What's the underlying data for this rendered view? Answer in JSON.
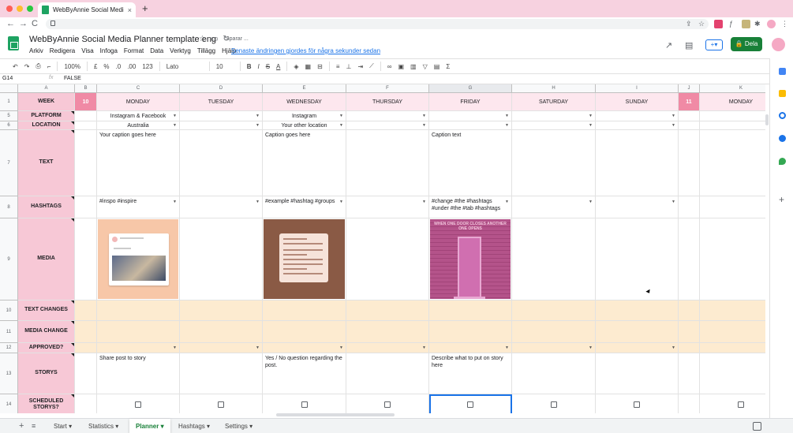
{
  "browser": {
    "tab_title": "WebByAnnie Social Media Planner template",
    "tab_close": "×",
    "new_tab": "+",
    "nav_back": "←",
    "nav_forward": "→",
    "nav_reload": "C",
    "dot_colors": [
      "#ff5f57",
      "#febc2e",
      "#28c840"
    ]
  },
  "doc": {
    "title": "WebByAnnie Social Media Planner template eng",
    "saving_status": "Sparar ...",
    "last_edit": "Senaste ändringen gjordes för några sekunder sedan",
    "share_label": "Dela",
    "menus": [
      "Arkiv",
      "Redigera",
      "Visa",
      "Infoga",
      "Format",
      "Data",
      "Verktyg",
      "Tillägg",
      "Hjälp"
    ]
  },
  "toolbar": {
    "zoom": "100%",
    "currency": "£",
    "percent": "%",
    "dec_less": ".0",
    "dec_more": ".00",
    "format_more": "123",
    "font": "Lato",
    "font_size": "10",
    "bold": "B",
    "italic": "I",
    "strike": "S",
    "text_color": "A",
    "sum": "Σ"
  },
  "formula_bar": {
    "cell_ref": "G14",
    "fx": "fx",
    "value": "FALSE"
  },
  "columns": [
    "A",
    "B",
    "C",
    "D",
    "E",
    "F",
    "G",
    "H",
    "I",
    "J",
    "K"
  ],
  "rows": {
    "numbers": [
      "1",
      "5",
      "6",
      "7",
      "8",
      "9",
      "10",
      "11",
      "12",
      "13",
      "14"
    ],
    "labels": [
      "WEEK",
      "PLATFORM",
      "LOCATION",
      "TEXT",
      "HASHTAGS",
      "MEDIA",
      "TEXT CHANGES",
      "MEDIA CHANGE",
      "APPROVED?",
      "STORYS",
      "SCHEDULED STORYS?"
    ]
  },
  "week": {
    "current": "10",
    "next": "11",
    "days": [
      "MONDAY",
      "TUESDAY",
      "WEDNESDAY",
      "THURSDAY",
      "FRIDAY",
      "SATURDAY",
      "SUNDAY"
    ],
    "next_days": [
      "MONDAY"
    ]
  },
  "cells": {
    "platform_mon": "Instagram & Facebook",
    "platform_wed": "Instagram",
    "location_mon": "Australia",
    "location_wed": "Your other location",
    "text_mon": "Your caption goes here",
    "text_wed": "Caption goes here",
    "text_fri": "Caption text",
    "hashtags_mon": "#inspo #inspire",
    "hashtags_wed": "#example #hashtag #groups",
    "hashtags_fri": "#change #the #hashtags #under #the #tab #hashtags",
    "story_mon": "Share post to story",
    "story_wed": "Yes / No question regarding the post.",
    "story_fri": "Describe what to put on story here"
  },
  "media": {
    "friday_headline": "WHEN ONE DOOR CLOSES ANOTHER ONE OPENS"
  },
  "sheet_tabs": [
    "Start",
    "Statistics",
    "Planner",
    "Hashtags",
    "Settings"
  ],
  "active_sheet": "Planner",
  "colors": {
    "pink_label": "#f7c8d6",
    "week_pink": "#f08aa5",
    "day_header": "#fde7ee",
    "changes_row": "#fdebd0",
    "share_green": "#188038"
  }
}
